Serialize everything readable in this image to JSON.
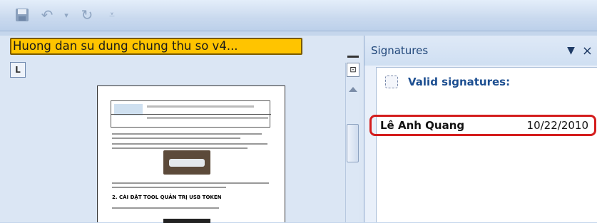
{
  "quick_access": {
    "save_icon": "save-icon",
    "undo_icon": "undo-icon",
    "redo_icon": "redo-icon",
    "more_icon": "customize-icon"
  },
  "document": {
    "title": "Huong dan su dung chung thu so v4...",
    "ruler_button": "L",
    "heading": "2. CÀI ĐẶT TOOL QUẢN TRỊ USB TOKEN"
  },
  "signatures_pane": {
    "title": "Signatures",
    "dropdown_glyph": "▼",
    "close_glyph": "×",
    "group_label": "Valid signatures:",
    "signatures": [
      {
        "name": "Lê Anh Quang",
        "date": "10/22/2010"
      }
    ]
  }
}
